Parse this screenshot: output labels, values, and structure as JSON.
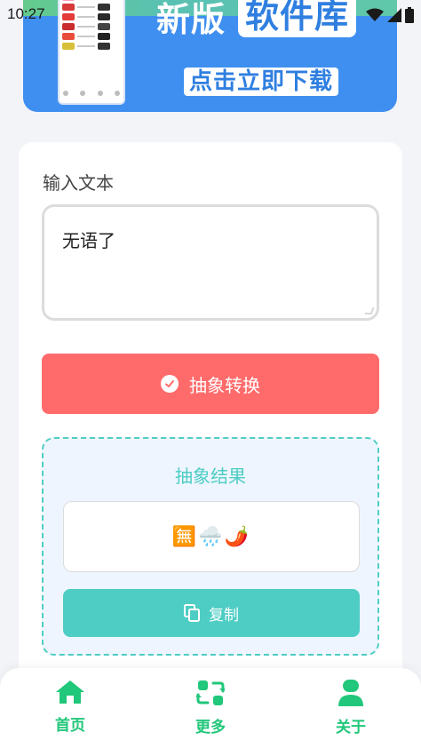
{
  "status_bar": {
    "time": "10:27"
  },
  "banner": {
    "title_left": "新版",
    "title_highlight": "软件库",
    "cta": "点击立即下载"
  },
  "form": {
    "input_label": "输入文本",
    "input_value": "无语了",
    "convert_button": "抽象转换"
  },
  "result": {
    "title": "抽象结果",
    "output": "🈚🌧️🌶️",
    "copy_button": "复制"
  },
  "nav": {
    "items": [
      {
        "label": "首页",
        "icon": "home-icon"
      },
      {
        "label": "更多",
        "icon": "refresh-icon"
      },
      {
        "label": "关于",
        "icon": "user-icon"
      }
    ]
  },
  "colors": {
    "accent_green": "#21c77a",
    "convert_red": "#ff6b6b",
    "teal": "#4ecdc4",
    "banner_blue": "#3f8ff0"
  }
}
